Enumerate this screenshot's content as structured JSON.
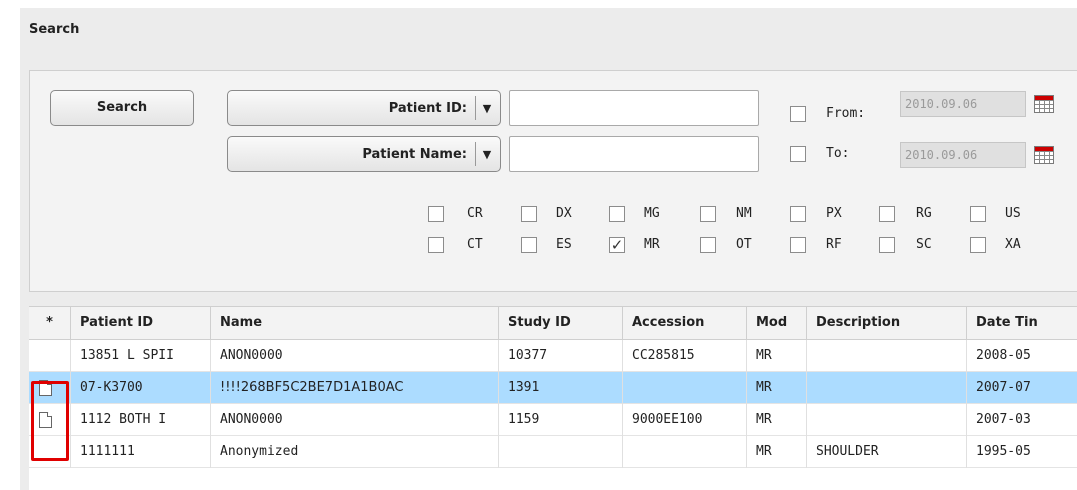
{
  "panel": {
    "title": "Search"
  },
  "form": {
    "search_button": "Search",
    "patient_id_label": "Patient ID:",
    "patient_name_label": "Patient Name:",
    "patient_id_value": "",
    "patient_name_value": "",
    "from_label": "From:",
    "to_label": "To:",
    "from_date": "2010.09.06",
    "to_date": "2010.09.06",
    "from_checked": false,
    "to_checked": false
  },
  "modalities": {
    "row1": [
      {
        "label": "CR",
        "checked": false
      },
      {
        "label": "DX",
        "checked": false
      },
      {
        "label": "MG",
        "checked": false
      },
      {
        "label": "NM",
        "checked": false
      },
      {
        "label": "PX",
        "checked": false
      },
      {
        "label": "RG",
        "checked": false
      },
      {
        "label": "US",
        "checked": false
      }
    ],
    "row2": [
      {
        "label": "CT",
        "checked": false
      },
      {
        "label": "ES",
        "checked": false
      },
      {
        "label": "MR",
        "checked": true
      },
      {
        "label": "OT",
        "checked": false
      },
      {
        "label": "RF",
        "checked": false
      },
      {
        "label": "SC",
        "checked": false
      },
      {
        "label": "XA",
        "checked": false
      }
    ]
  },
  "table": {
    "headers": [
      "*",
      "Patient ID",
      "Name",
      "Study ID",
      "Accession",
      "Mod",
      "Description",
      "Date Tin"
    ],
    "rows": [
      [
        "",
        "13851 L SPII",
        "ANON0000",
        "10377",
        "CC285815",
        "MR",
        "",
        "2008-05"
      ],
      [
        "doc",
        "07-K3700",
        "!!!!268BF5C2BE7D1A1B0AC",
        "1391",
        "",
        "MR",
        "",
        "2007-07"
      ],
      [
        "doc",
        "1112 BOTH I",
        "ANON0000",
        "1159",
        "9000EE100",
        "MR",
        "",
        "2007-03"
      ],
      [
        "",
        "1111111",
        "Anonymized",
        "",
        "",
        "MR",
        "SHOULDER",
        "1995-05"
      ]
    ],
    "selected_row": 1
  }
}
